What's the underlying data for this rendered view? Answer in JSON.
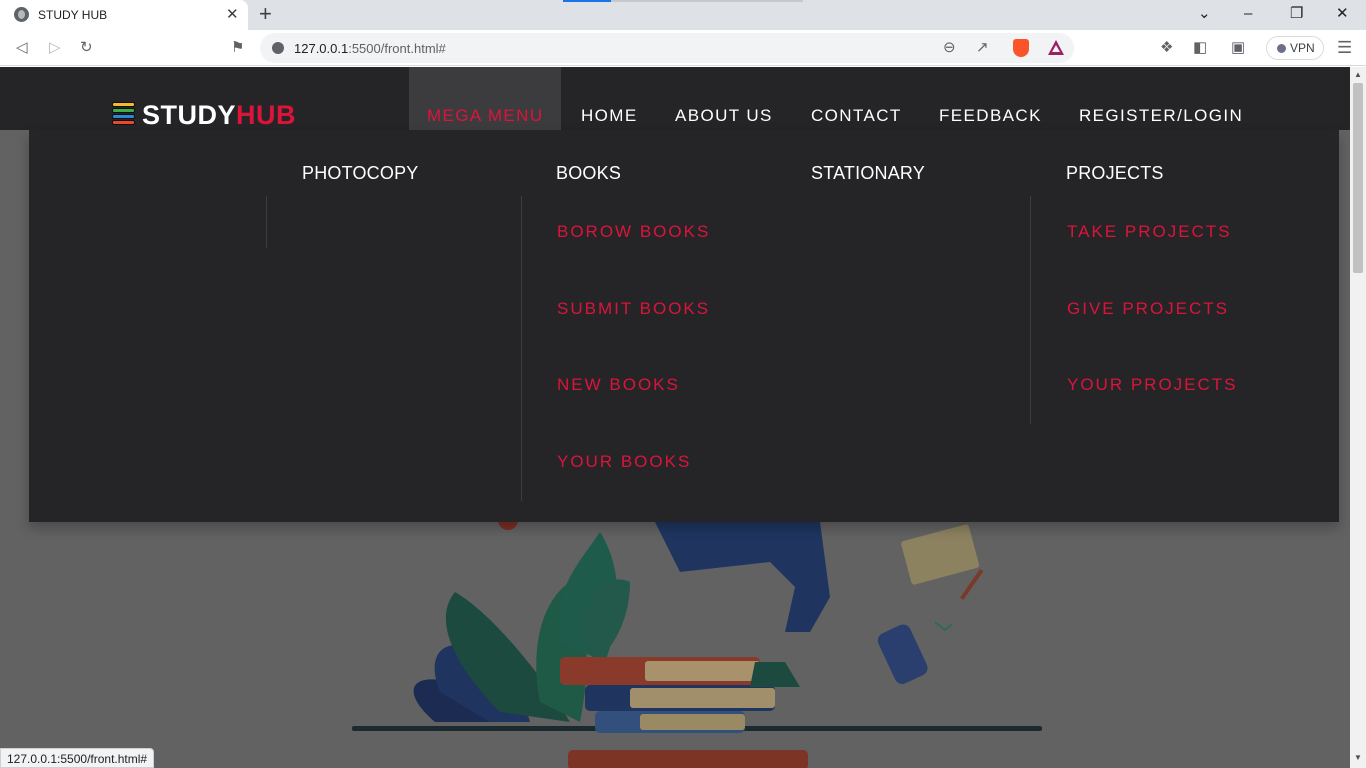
{
  "browser": {
    "tab_title": "STUDY HUB",
    "tab_close": "✕",
    "new_tab": "+",
    "url_host": "127.0.0.1",
    "url_path": ":5500/front.html#",
    "vpn_label": "VPN",
    "status_url": "127.0.0.1:5500/front.html#"
  },
  "site": {
    "logo_study": "STUDY",
    "logo_hub": "HUB",
    "nav": {
      "mega": "MEGA MENU",
      "home": "HOME",
      "about": "ABOUT US",
      "contact": "CONTACT",
      "feedback": "FEEDBACK",
      "register": "REGISTER/LOGIN"
    },
    "mega_menu": {
      "photocopy": {
        "heading": "PHOTOCOPY"
      },
      "books": {
        "heading": "BOOKS",
        "links": [
          "BOROW BOOKS",
          "SUBMIT BOOKS",
          "NEW BOOKS",
          "YOUR BOOKS"
        ]
      },
      "stationary": {
        "heading": "STATIONARY"
      },
      "projects": {
        "heading": "PROJECTS",
        "links": [
          "TAKE PROJECTS",
          "GIVE PROJECTS",
          "YOUR PROJECTS"
        ]
      }
    }
  },
  "colors": {
    "accent": "#dc143c",
    "navbar_bg": "#252527",
    "overlay_bg": "#626262"
  }
}
